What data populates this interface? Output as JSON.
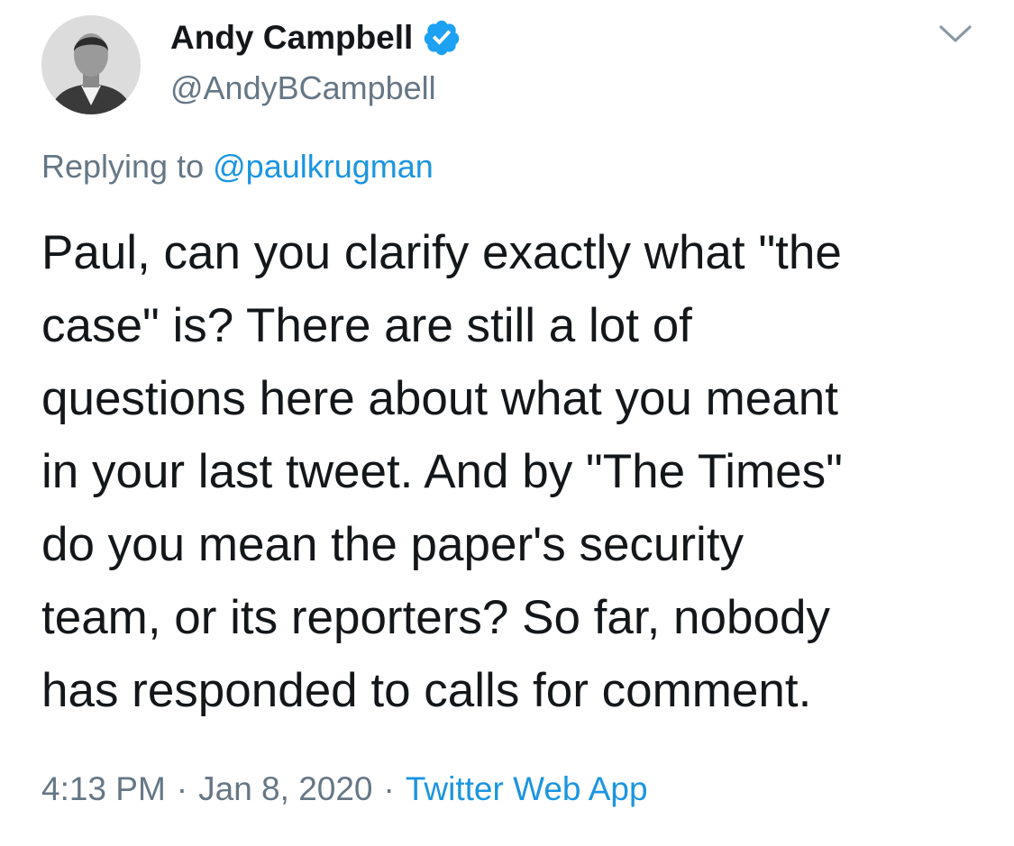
{
  "author": {
    "display_name": "Andy Campbell",
    "handle": "@AndyBCampbell",
    "verified": true
  },
  "reply": {
    "prefix": "Replying to",
    "mention": "@paulkrugman"
  },
  "tweet": {
    "lines": [
      "Paul, can you clarify exactly what \"the",
      "case\" is? There are still a lot of",
      "questions here about what you meant",
      "in your last tweet. And by \"The Times\"",
      "do you mean the paper's security",
      "team, or its reporters? So far, nobody",
      "has responded to calls for comment."
    ]
  },
  "meta": {
    "time": "4:13 PM",
    "separator": "·",
    "date": "Jan 8, 2020",
    "source": "Twitter Web App"
  },
  "colors": {
    "accent": "#1b95e0",
    "secondary_text": "#657786",
    "primary_text": "#14171a",
    "verified_badge": "#1da1f2"
  },
  "icons": {
    "verified": "verified-badge-icon",
    "menu": "chevron-down-icon"
  }
}
